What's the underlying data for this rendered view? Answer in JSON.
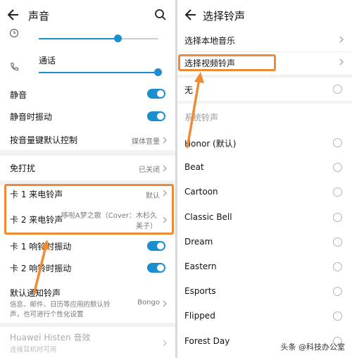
{
  "left": {
    "header_title": "声音",
    "call_label": "通话",
    "sound_rows": [
      {
        "label": "静音"
      },
      {
        "label": "静音时振动"
      }
    ],
    "volume_key": {
      "label": "按音量键默认控制",
      "value": "媒体音量"
    },
    "dnd": {
      "label": "免打扰",
      "value": "已关闭"
    },
    "card1_ringtone": {
      "label": "卡 1 来电铃声",
      "value": "默认"
    },
    "card2_ringtone": {
      "label": "卡 2 来电铃声",
      "value_line1": "哆啦A梦之歌（Cover：木杉久",
      "value_line2": "美子）"
    },
    "card1_vibrate": {
      "label": "卡 1 响铃时振动"
    },
    "card2_vibrate": {
      "label": "卡 2 响铃时振动"
    },
    "notification": {
      "label": "默认通知铃声",
      "desc_line1": "信息、邮件、日历等应用的默认铃",
      "desc_line2": "声，也可进行个性化设置",
      "value": "Bongo"
    },
    "histen": {
      "label": "Huawei Histen 音效",
      "desc": "连接耳机时可用"
    }
  },
  "right": {
    "header_title": "选择铃声",
    "local_music": "选择本地音乐",
    "video_ringtone": "选择视频铃声",
    "none_label": "无",
    "section_title": "系统铃声",
    "ringtones": [
      "Honor (默认)",
      "Beat",
      "Cartoon",
      "Classic Bell",
      "Dream",
      "Eastern",
      "Esports",
      "Flipped",
      "Forest Day"
    ]
  },
  "watermark": "头条 @科技办公室",
  "colors": {
    "accent": "#1a8ecf",
    "highlight": "#ef8a36"
  }
}
